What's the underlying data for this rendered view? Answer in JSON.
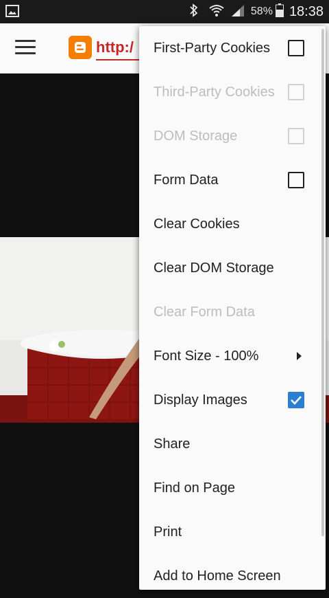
{
  "status_bar": {
    "battery_percent": "58%",
    "time": "18:38"
  },
  "toolbar": {
    "url_text": "http:/"
  },
  "menu": {
    "items": [
      {
        "label": "First-Party Cookies",
        "enabled": true,
        "control": "checkbox",
        "checked": false
      },
      {
        "label": "Third-Party Cookies",
        "enabled": false,
        "control": "checkbox",
        "checked": false
      },
      {
        "label": "DOM Storage",
        "enabled": false,
        "control": "checkbox",
        "checked": false
      },
      {
        "label": "Form Data",
        "enabled": true,
        "control": "checkbox",
        "checked": false
      },
      {
        "label": "Clear Cookies",
        "enabled": true,
        "control": "none"
      },
      {
        "label": "Clear DOM Storage",
        "enabled": true,
        "control": "none"
      },
      {
        "label": "Clear Form Data",
        "enabled": false,
        "control": "none"
      },
      {
        "label": "Font Size - 100%",
        "enabled": true,
        "control": "submenu"
      },
      {
        "label": "Display Images",
        "enabled": true,
        "control": "checkbox",
        "checked": true
      },
      {
        "label": "Share",
        "enabled": true,
        "control": "none"
      },
      {
        "label": "Find on Page",
        "enabled": true,
        "control": "none"
      },
      {
        "label": "Print",
        "enabled": true,
        "control": "none"
      },
      {
        "label": "Add to Home Screen",
        "enabled": true,
        "control": "none"
      }
    ]
  },
  "colors": {
    "accent": "#2a7fd2",
    "url_red": "#c62828",
    "blogger_orange": "#f57d00",
    "disabled_text": "#bdbdbd"
  }
}
